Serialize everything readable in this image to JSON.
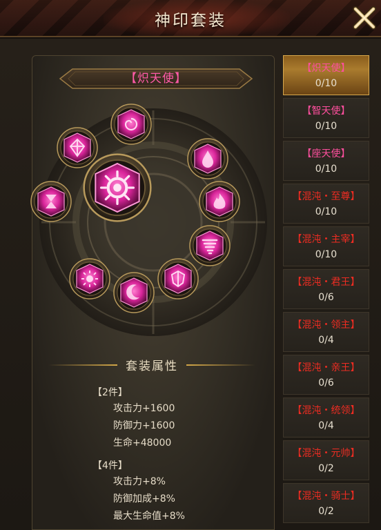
{
  "header": {
    "title": "神印套装"
  },
  "set": {
    "name": "【炽天使】"
  },
  "attributes": {
    "title": "套装属性",
    "groups": [
      {
        "label": "【2件】",
        "lines": [
          "攻击力+1600",
          "防御力+1600",
          "生命+48000"
        ]
      },
      {
        "label": "【4件】",
        "lines": [
          "攻击力+8%",
          "防御加成+8%",
          "最大生命值+8%"
        ]
      }
    ]
  },
  "sets": [
    {
      "name": "【炽天使】",
      "count": "0/10",
      "color": "pink",
      "active": true
    },
    {
      "name": "【智天使】",
      "count": "0/10",
      "color": "pink",
      "active": false
    },
    {
      "name": "【座天使】",
      "count": "0/10",
      "color": "pink",
      "active": false
    },
    {
      "name": "【混沌・至尊】",
      "count": "0/10",
      "color": "red",
      "active": false
    },
    {
      "name": "【混沌・主宰】",
      "count": "0/10",
      "color": "red",
      "active": false
    },
    {
      "name": "【混沌・君王】",
      "count": "0/6",
      "color": "red",
      "active": false
    },
    {
      "name": "【混沌・领主】",
      "count": "0/4",
      "color": "red",
      "active": false
    },
    {
      "name": "【混沌・亲王】",
      "count": "0/6",
      "color": "red",
      "active": false
    },
    {
      "name": "【混沌・统领】",
      "count": "0/4",
      "color": "red",
      "active": false
    },
    {
      "name": "【混沌・元帅】",
      "count": "0/2",
      "color": "red",
      "active": false
    },
    {
      "name": "【混沌・骑士】",
      "count": "0/2",
      "color": "red",
      "active": false
    }
  ],
  "gems": [
    {
      "icon": "spiral-rune-icon"
    },
    {
      "icon": "crystal-rune-icon"
    },
    {
      "icon": "droplet-rune-icon"
    },
    {
      "icon": "hourglass-rune-icon"
    },
    {
      "icon": "flame-rune-icon"
    },
    {
      "icon": "tornado-rune-icon"
    },
    {
      "icon": "sun-rune-icon"
    },
    {
      "icon": "crescent-rune-icon"
    },
    {
      "icon": "shield-rune-icon"
    },
    {
      "icon": "eye-rune-icon"
    }
  ],
  "colors": {
    "accent_gold": "#d4a848",
    "gem_pink": "#ff3fae",
    "pink_text": "#ff4f9e",
    "red_text": "#ee2c22"
  }
}
